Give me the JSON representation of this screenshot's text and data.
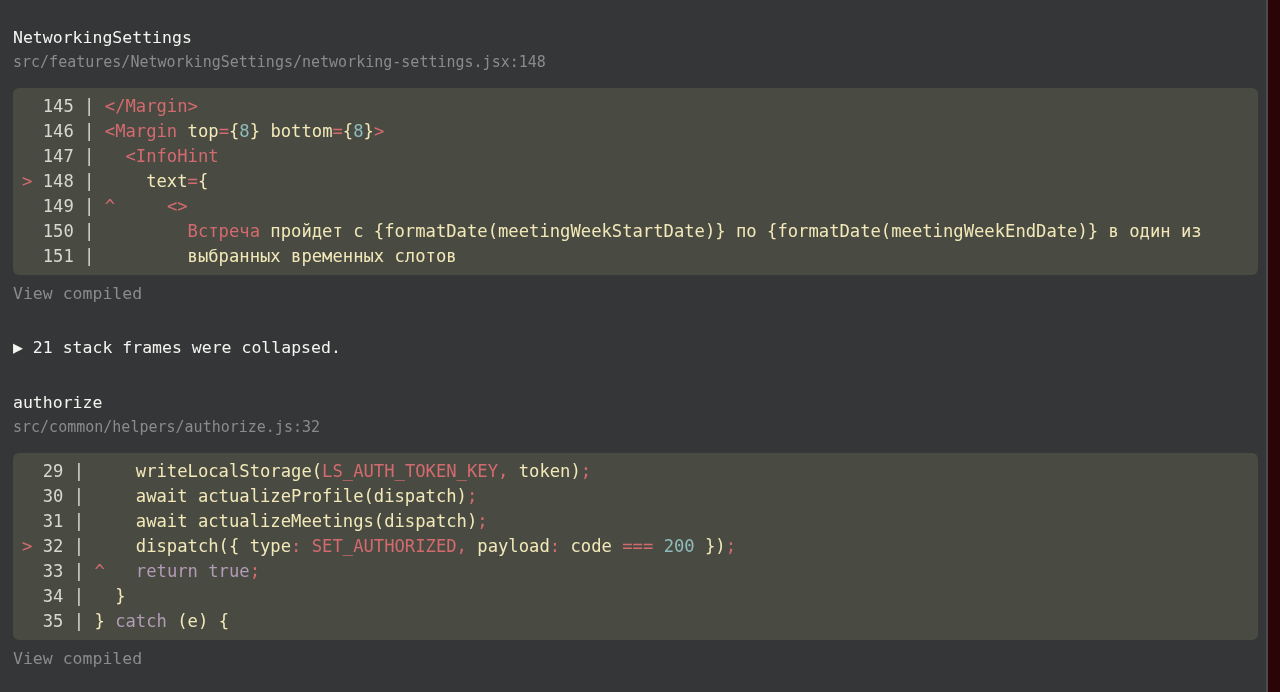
{
  "items": [
    {
      "kind": "frame",
      "function": "NetworkingSettings",
      "file": "src/features/NetworkingSettings/networking-settings.jsx:148",
      "lines": [
        {
          "number": "145",
          "separator": "|",
          "tokens": [
            {
              "t": "</Margin>",
              "kind": "red"
            }
          ]
        },
        {
          "number": "146",
          "separator": "|",
          "tokens": [
            {
              "t": "<Margin",
              "kind": "red"
            },
            {
              "t": " top",
              "kind": "plain"
            },
            {
              "t": "=",
              "kind": "red"
            },
            {
              "t": "{",
              "kind": "plain"
            },
            {
              "t": "8",
              "kind": "num"
            },
            {
              "t": "} bottom",
              "kind": "plain"
            },
            {
              "t": "=",
              "kind": "red"
            },
            {
              "t": "{",
              "kind": "plain"
            },
            {
              "t": "8",
              "kind": "num"
            },
            {
              "t": "}",
              "kind": "plain"
            },
            {
              "t": ">",
              "kind": "red"
            }
          ]
        },
        {
          "number": "147",
          "separator": "|",
          "tokens": [
            {
              "t": "  <InfoHint",
              "kind": "red"
            }
          ]
        },
        {
          "marker": ">",
          "number": "148",
          "separator": "|",
          "tokens": [
            {
              "t": "    text",
              "kind": "plain"
            },
            {
              "t": "=",
              "kind": "red"
            },
            {
              "t": "{",
              "kind": "plain"
            }
          ]
        },
        {
          "number": "149",
          "separator": "|",
          "tokens": [
            {
              "t": "^",
              "kind": "red"
            },
            {
              "t": "     <>",
              "kind": "red"
            }
          ]
        },
        {
          "number": "150",
          "separator": "|",
          "tokens": [
            {
              "t": "        Встреча",
              "kind": "red"
            },
            {
              "t": " пройдет с {formatDate(meetingWeekStartDate)} по {formatDate(meetingWeekEndDate)} в один из",
              "kind": "plain"
            }
          ]
        },
        {
          "number": "151",
          "separator": "|",
          "tokens": [
            {
              "t": "        выбранных временных слотов",
              "kind": "plain"
            }
          ]
        }
      ],
      "view_compiled": "View compiled"
    },
    {
      "kind": "collapsed",
      "toggle": "▶",
      "label": "21 stack frames were collapsed."
    },
    {
      "kind": "frame",
      "function": "authorize",
      "file": "src/common/helpers/authorize.js:32",
      "lines": [
        {
          "number": "29",
          "separator": "|",
          "tokens": [
            {
              "t": "    writeLocalStorage(",
              "kind": "plain"
            },
            {
              "t": "LS_AUTH_TOKEN_KEY,",
              "kind": "red"
            },
            {
              "t": " token)",
              "kind": "plain"
            },
            {
              "t": ";",
              "kind": "red"
            }
          ]
        },
        {
          "number": "30",
          "separator": "|",
          "tokens": [
            {
              "t": "    await actualizeProfile(dispatch)",
              "kind": "plain"
            },
            {
              "t": ";",
              "kind": "red"
            }
          ]
        },
        {
          "number": "31",
          "separator": "|",
          "tokens": [
            {
              "t": "    await actualizeMeetings(dispatch)",
              "kind": "plain"
            },
            {
              "t": ";",
              "kind": "red"
            }
          ]
        },
        {
          "marker": ">",
          "number": "32",
          "separator": "|",
          "tokens": [
            {
              "t": "    dispatch({ type",
              "kind": "plain"
            },
            {
              "t": ": SET_AUTHORIZED,",
              "kind": "red"
            },
            {
              "t": " payload",
              "kind": "plain"
            },
            {
              "t": ":",
              "kind": "red"
            },
            {
              "t": " code ",
              "kind": "plain"
            },
            {
              "t": "=== ",
              "kind": "red"
            },
            {
              "t": "200",
              "kind": "num"
            },
            {
              "t": " })",
              "kind": "plain"
            },
            {
              "t": ";",
              "kind": "red"
            }
          ]
        },
        {
          "number": "33",
          "separator": "|",
          "tokens": [
            {
              "t": "^",
              "kind": "red"
            },
            {
              "t": "   return true",
              "kind": "kw"
            },
            {
              "t": ";",
              "kind": "red"
            }
          ]
        },
        {
          "number": "34",
          "separator": "|",
          "tokens": [
            {
              "t": "  }",
              "kind": "plain"
            }
          ]
        },
        {
          "number": "35",
          "separator": "|",
          "tokens": [
            {
              "t": "} ",
              "kind": "plain"
            },
            {
              "t": "catch",
              "kind": "kw"
            },
            {
              "t": " (e) {",
              "kind": "plain"
            }
          ]
        }
      ],
      "view_compiled": "View compiled"
    }
  ]
}
